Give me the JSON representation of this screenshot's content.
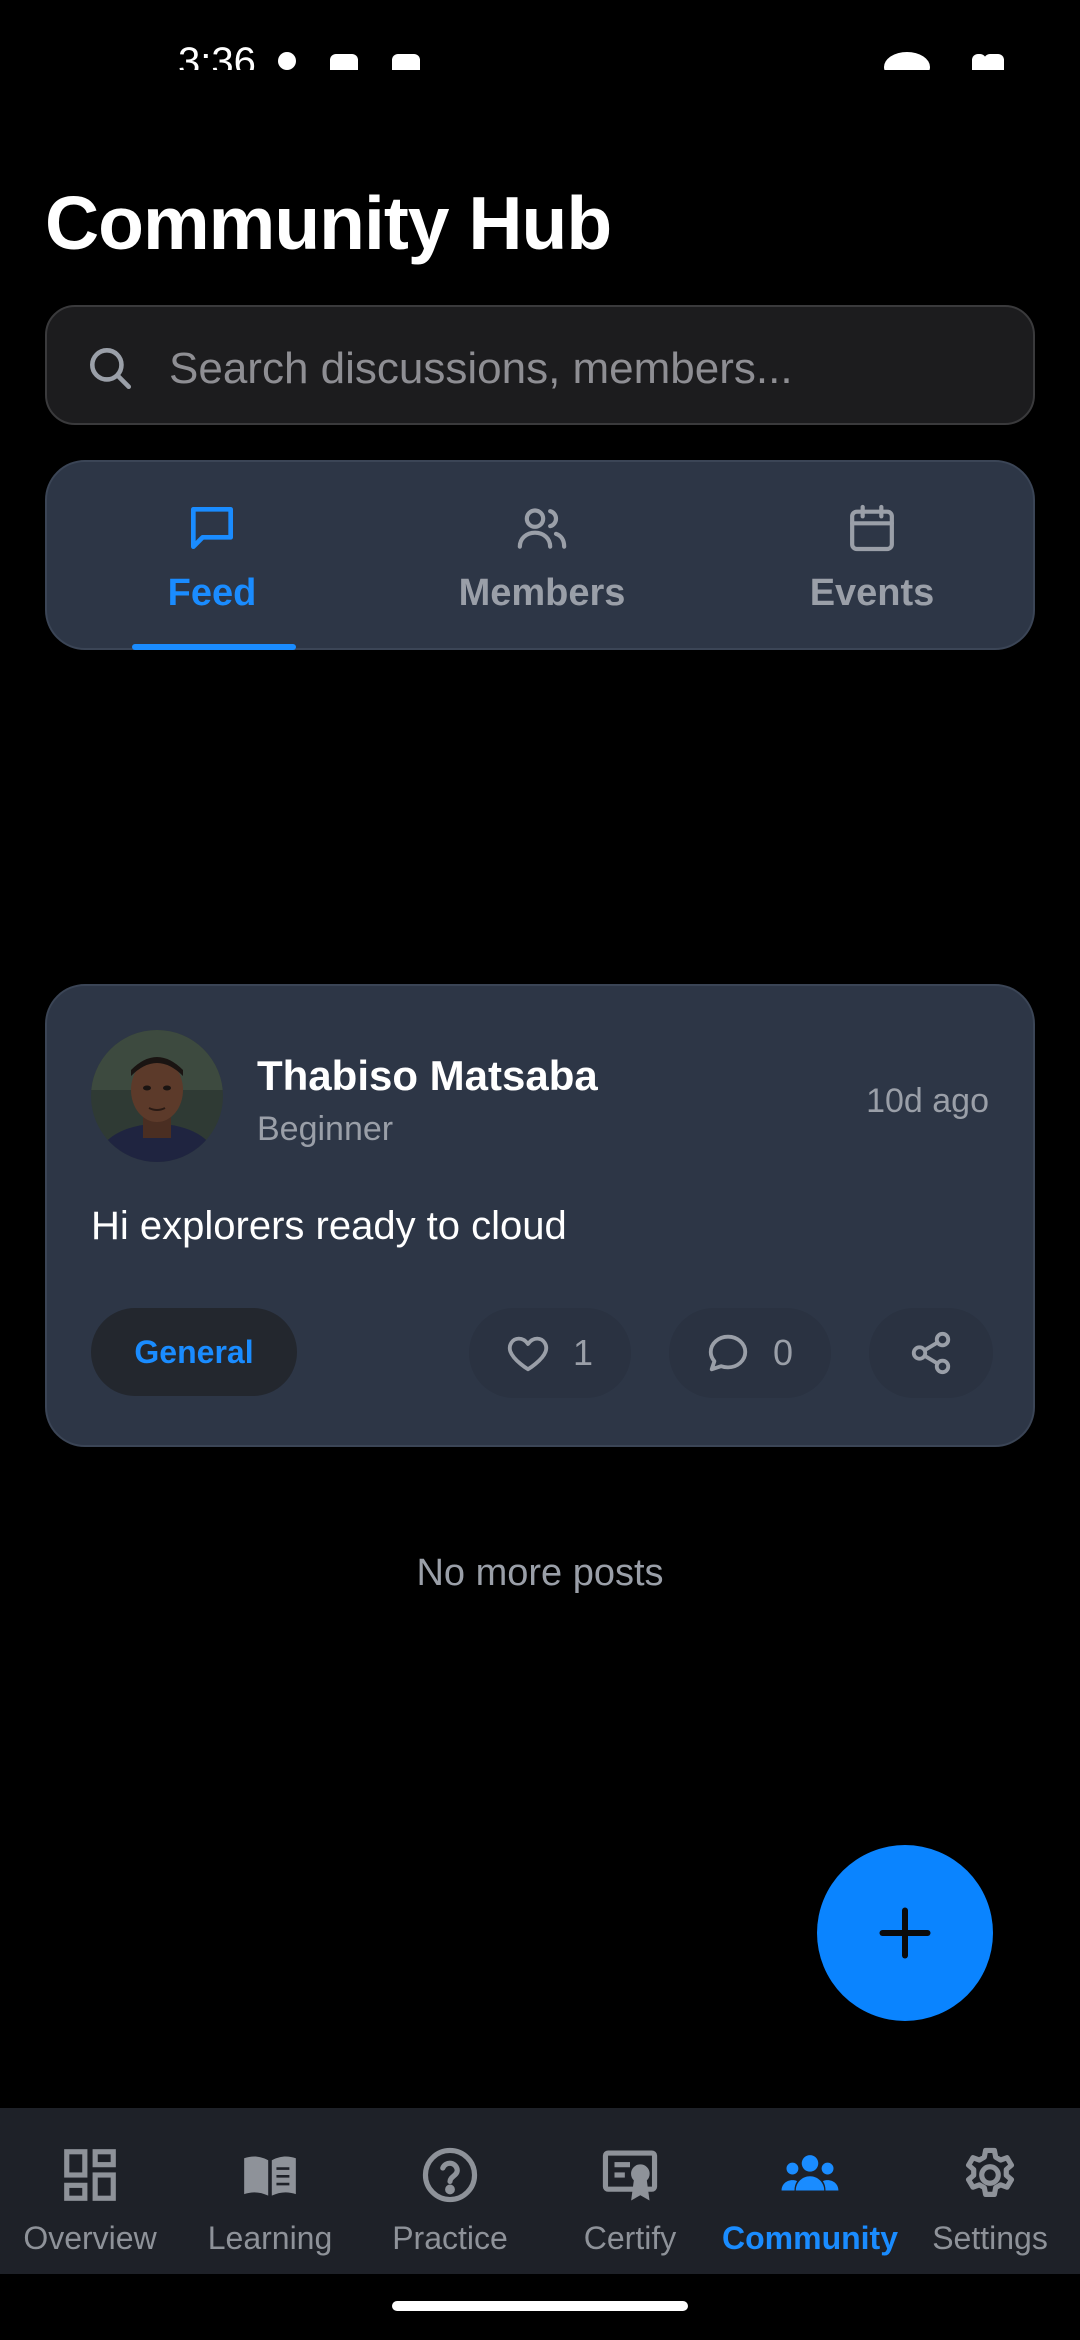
{
  "status_bar": {
    "time": "3:36"
  },
  "header": {
    "title": "Community Hub"
  },
  "search": {
    "placeholder": "Search discussions, members..."
  },
  "tabs": [
    {
      "label": "Feed",
      "icon": "message-square-icon",
      "active": true
    },
    {
      "label": "Members",
      "icon": "users-icon",
      "active": false
    },
    {
      "label": "Events",
      "icon": "calendar-icon",
      "active": false
    }
  ],
  "feed": {
    "posts": [
      {
        "author": "Thabiso Matsaba",
        "level": "Beginner",
        "time": "10d ago",
        "body": "Hi explorers ready to cloud",
        "tag": "General",
        "likes": "1",
        "comments": "0"
      }
    ],
    "end_text": "No more posts"
  },
  "fab": {
    "icon": "plus-icon"
  },
  "bottom_nav": [
    {
      "label": "Overview",
      "icon": "dashboard-icon",
      "active": false
    },
    {
      "label": "Learning",
      "icon": "book-icon",
      "active": false
    },
    {
      "label": "Practice",
      "icon": "help-circle-icon",
      "active": false
    },
    {
      "label": "Certify",
      "icon": "certificate-icon",
      "active": false
    },
    {
      "label": "Community",
      "icon": "community-icon",
      "active": true
    },
    {
      "label": "Settings",
      "icon": "gear-icon",
      "active": false
    }
  ],
  "colors": {
    "background": "#000000",
    "card": "#2d3646",
    "accent": "#1a8cff",
    "fab": "#0a84ff",
    "muted_text": "#9a9fa8",
    "nav_background": "#1e2128"
  }
}
